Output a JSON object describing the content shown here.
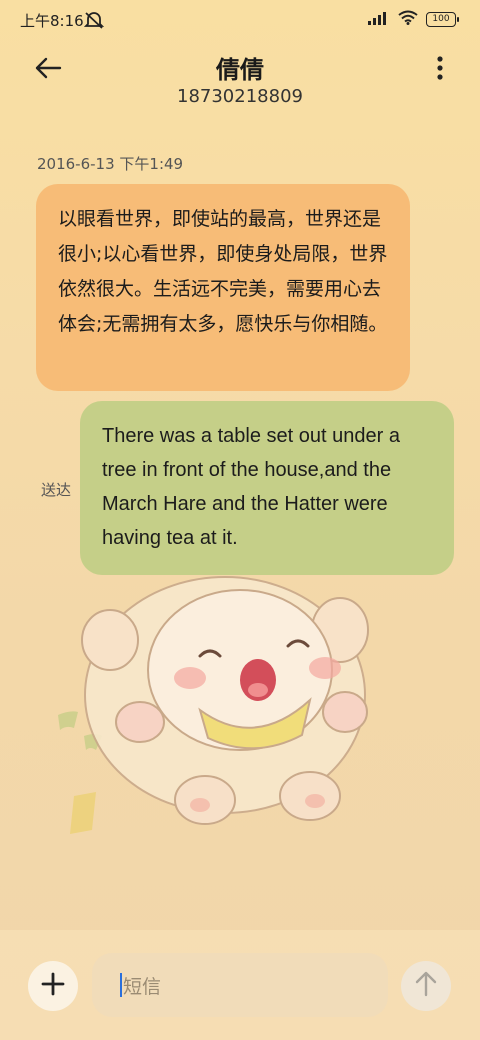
{
  "status_bar": {
    "time": "上午8:16",
    "battery": "100",
    "icons": [
      "dnd-icon",
      "signal-icon",
      "wifi-icon",
      "battery-icon"
    ]
  },
  "header": {
    "title": "倩倩",
    "subtitle": "18730218809",
    "icons": [
      "back-arrow-icon",
      "more-vertical-icon"
    ]
  },
  "conversation": {
    "timestamp": "2016-6-13 下午1:49",
    "incoming": {
      "text": "以眼看世界，即使站的最高，世界还是很小;以心看世界，即使身处局限，世界依然很大。生活远不完美，需要用心去体会;无需拥有太多，愿快乐与你相随。"
    },
    "outgoing": {
      "text": "There was a table set out under a tree in front of the house,and the March Hare and the Hatter were having tea at it.",
      "status": "送达"
    }
  },
  "composer": {
    "placeholder": "短信",
    "icons": [
      "plus-icon",
      "send-arrow-icon"
    ]
  },
  "colors": {
    "incoming_bubble": "#f7bc77",
    "outgoing_bubble": "#c5cf88",
    "background": "#f6dba8",
    "caret": "#2a6fdb"
  }
}
